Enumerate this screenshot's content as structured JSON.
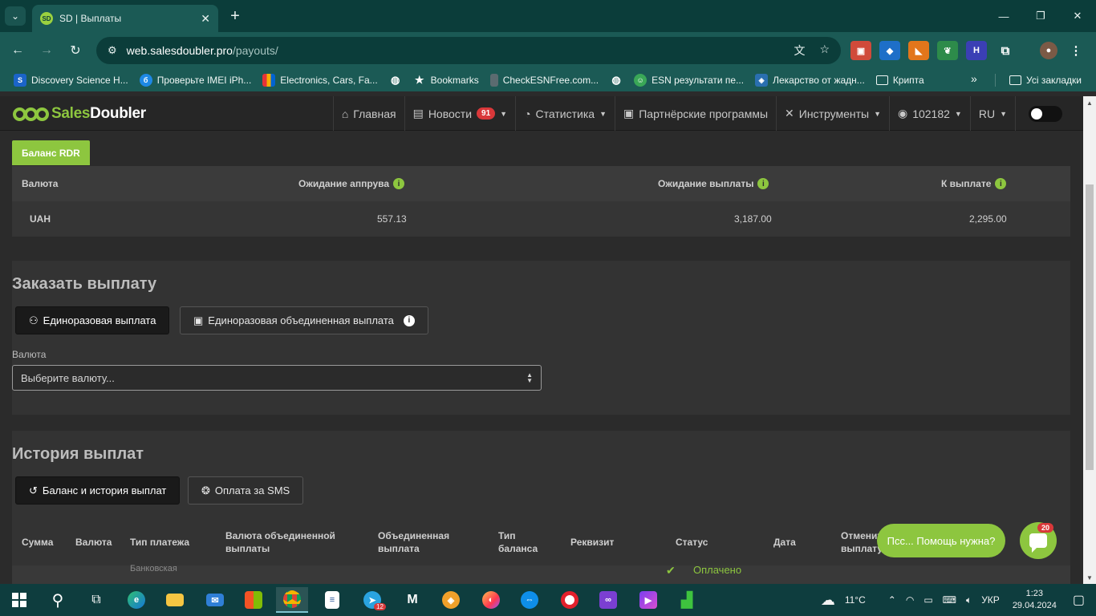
{
  "browser": {
    "tab_title": "SD | Выплаты",
    "tab_favicon": "SD",
    "url_host": "web.salesdoubler.pro",
    "url_path": "/payouts/",
    "bookmarks": [
      "Discovery Science H...",
      "Проверьте IMEI iPh...",
      "Electronics, Cars, Fa...",
      "",
      "Bookmarks",
      "CheckESNFree.com...",
      "",
      "ESN результати пе...",
      "Лекарство от жадн...",
      "Крипта"
    ],
    "all_bookmarks": "Усі закладки"
  },
  "navbar": {
    "logo_green": "Sales",
    "logo_white": "Doubler",
    "home": "Главная",
    "news": "Новости",
    "news_badge": "91",
    "stats": "Статистика",
    "programs": "Партнёрские программы",
    "tools": "Инструменты",
    "account": "102182",
    "lang": "RU"
  },
  "balance": {
    "tab_label": "Баланс RDR",
    "headers": {
      "currency": "Валюта",
      "pending_approval": "Ожидание аппрува",
      "pending_payout": "Ожидание выплаты",
      "to_payout": "К выплате"
    },
    "row": {
      "currency": "UAH",
      "pending_approval": "557.13",
      "pending_payout": "3,187.00",
      "to_payout": "2,295.00"
    }
  },
  "order": {
    "title": "Заказать выплату",
    "btn_single": "Единоразовая выплата",
    "btn_combined": "Единоразовая объединенная выплата",
    "currency_label": "Валюта",
    "currency_placeholder": "Выберите валюту..."
  },
  "history": {
    "title": "История выплат",
    "btn_balance": "Баланс и история выплат",
    "btn_sms": "Оплата за SMS",
    "columns": {
      "sum": "Сумма",
      "currency": "Валюта",
      "payment_type": "Тип платежа",
      "combined_currency": "Валюта объединенной выплаты",
      "combined": "Объединенная выплата",
      "balance_type": "Тип баланса",
      "requisite": "Реквизит",
      "status": "Статус",
      "date": "Дата",
      "cancel": "Отменить выплату"
    },
    "first_row": {
      "payment_type": "Банковская",
      "status": "Оплачено"
    }
  },
  "chat": {
    "bubble": "Псс... Помощь нужна?",
    "count": "20"
  },
  "taskbar": {
    "weather": "11°C",
    "lang": "УКР",
    "time": "1:23",
    "date": "29.04.2024",
    "telegram_badge": "12"
  },
  "colors": {
    "accent_green": "#8dc63f",
    "chrome_dark": "#0b3d3a",
    "chrome_toolbar": "#1b5a55",
    "badge_red": "#d9383a"
  }
}
